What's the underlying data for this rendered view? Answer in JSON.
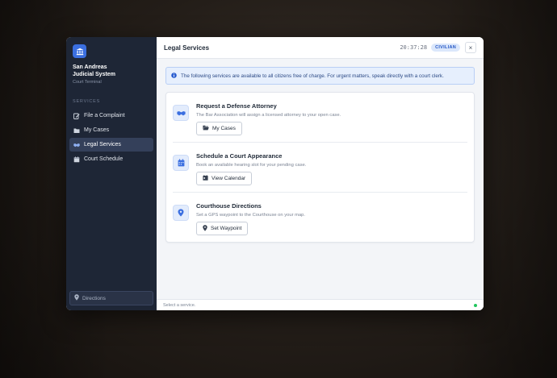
{
  "sidebar": {
    "brand_title_line1": "San Andreas",
    "brand_title_line2": "Judicial System",
    "brand_subtitle": "Court Terminal",
    "brand_icon": "courthouse-icon",
    "section_label": "SERVICES",
    "items": [
      {
        "label": "File a Complaint",
        "icon": "edit-icon",
        "active": false
      },
      {
        "label": "My Cases",
        "icon": "folder-icon",
        "active": false
      },
      {
        "label": "Legal Services",
        "icon": "handshake-icon",
        "active": true
      },
      {
        "label": "Court Schedule",
        "icon": "calendar-icon",
        "active": false
      }
    ],
    "directions_label": "Directions"
  },
  "header": {
    "title": "Legal Services",
    "clock": "20:37:28",
    "badge": "CIVILIAN",
    "close_label": "×"
  },
  "info": {
    "text": "The following services are available to all citizens free of charge. For urgent matters, speak directly with a court clerk."
  },
  "services": [
    {
      "title": "Request a Defense Attorney",
      "description": "The Bar Association will assign a licensed attorney to your open case.",
      "button_label": "My Cases",
      "icon": "handshake-icon",
      "button_icon": "folder-open-icon"
    },
    {
      "title": "Schedule a Court Appearance",
      "description": "Book an available hearing slot for your pending case.",
      "button_label": "View Calendar",
      "icon": "calendar-icon",
      "button_icon": "calendar-day-icon"
    },
    {
      "title": "Courthouse Directions",
      "description": "Set a GPS waypoint to the Courthouse on your map.",
      "button_label": "Set Waypoint",
      "icon": "map-pin-icon",
      "button_icon": "map-pin-icon"
    }
  ],
  "footer": {
    "status_text": "Select a service."
  },
  "colors": {
    "accent": "#3b6fe0",
    "sidebar_bg": "#1e2636",
    "status_ok": "#22c55e"
  }
}
